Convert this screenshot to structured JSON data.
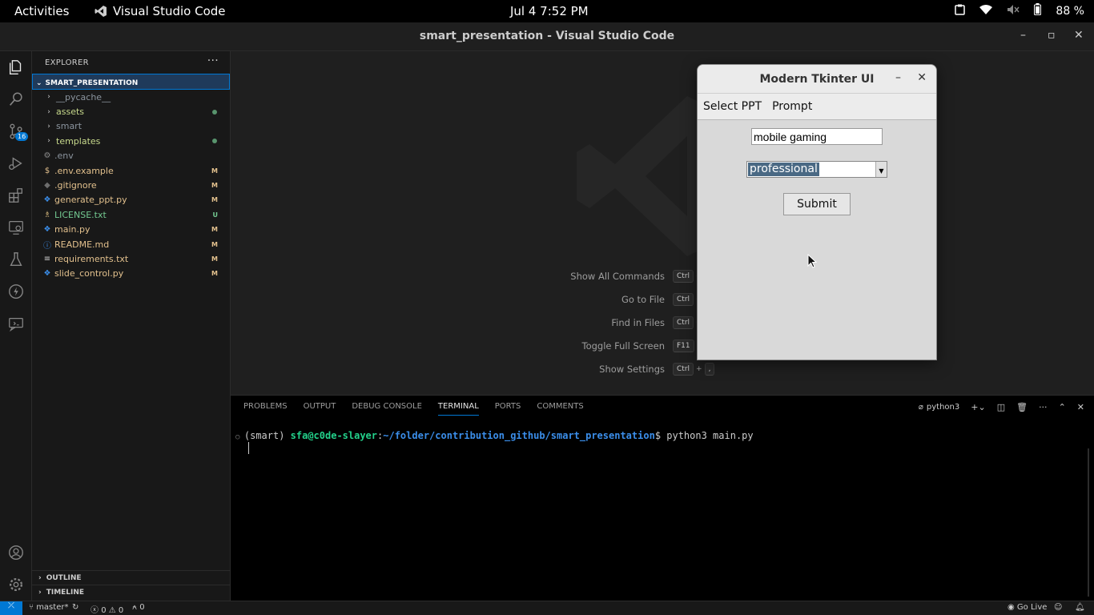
{
  "topbar": {
    "activities": "Activities",
    "app_name": "Visual Studio Code",
    "clock": "Jul 4   7:52 PM",
    "battery": "88 %"
  },
  "window": {
    "title": "smart_presentation - Visual Studio Code",
    "minimize": "–",
    "maximize": "▫",
    "close": "✕"
  },
  "activity_bar": {
    "scm_badge": "16"
  },
  "explorer": {
    "header": "EXPLORER",
    "more": "···",
    "project": "SMART_PRESENTATION",
    "items": [
      {
        "name": "__pycache__",
        "type": "folder",
        "color": "#8b949e",
        "decoration": ""
      },
      {
        "name": "assets",
        "type": "folder",
        "color": "#c7d98c",
        "decoration": "dot"
      },
      {
        "name": "smart",
        "type": "folder",
        "color": "#8b949e",
        "decoration": ""
      },
      {
        "name": "templates",
        "type": "folder",
        "color": "#c7d98c",
        "decoration": "dot"
      },
      {
        "name": ".env",
        "type": "file",
        "icon": "⚙",
        "icon_color": "#8a8a8a",
        "color": "#8b949e",
        "decoration": ""
      },
      {
        "name": ".env.example",
        "type": "file",
        "icon": "$",
        "icon_color": "#e2c08d",
        "color": "#e2c08d",
        "decoration": "M"
      },
      {
        "name": ".gitignore",
        "type": "file",
        "icon": "◆",
        "icon_color": "#6d6d6d",
        "color": "#e2c08d",
        "decoration": "M"
      },
      {
        "name": "generate_ppt.py",
        "type": "file",
        "icon": "❖",
        "icon_color": "#3b8eea",
        "color": "#e2c08d",
        "decoration": "M"
      },
      {
        "name": "LICENSE.txt",
        "type": "file",
        "icon": "♗",
        "icon_color": "#d7ba7d",
        "color": "#73c991",
        "decoration": "U"
      },
      {
        "name": "main.py",
        "type": "file",
        "icon": "❖",
        "icon_color": "#3b8eea",
        "color": "#e2c08d",
        "decoration": "M"
      },
      {
        "name": "README.md",
        "type": "file",
        "icon": "ⓘ",
        "icon_color": "#3b8eea",
        "color": "#e2c08d",
        "decoration": "M"
      },
      {
        "name": "requirements.txt",
        "type": "file",
        "icon": "≡",
        "icon_color": "#cccccc",
        "color": "#e2c08d",
        "decoration": "M"
      },
      {
        "name": "slide_control.py",
        "type": "file",
        "icon": "❖",
        "icon_color": "#3b8eea",
        "color": "#e2c08d",
        "decoration": "M"
      }
    ],
    "outline": "OUTLINE",
    "timeline": "TIMELINE"
  },
  "welcome": {
    "shortcuts": [
      {
        "label": "Show All Commands",
        "keys": [
          "Ctrl",
          "+"
        ]
      },
      {
        "label": "Go to File",
        "keys": [
          "Ctrl",
          "+"
        ]
      },
      {
        "label": "Find in Files",
        "keys": [
          "Ctrl",
          "+"
        ]
      },
      {
        "label": "Toggle Full Screen",
        "keys": [
          "F11"
        ]
      },
      {
        "label": "Show Settings",
        "keys": [
          "Ctrl",
          "+",
          ","
        ]
      }
    ]
  },
  "panel": {
    "tabs": [
      "PROBLEMS",
      "OUTPUT",
      "DEBUG CONSOLE",
      "TERMINAL",
      "PORTS",
      "COMMENTS"
    ],
    "active_tab": "TERMINAL",
    "shell": "python3",
    "terminal": {
      "env": "(smart) ",
      "user_host": "sfa@c0de-slayer",
      "path": "~/folder/contribution_github/smart_presentation",
      "command": "$ python3 main.py"
    }
  },
  "statusbar": {
    "branch": "master*",
    "errors": "0",
    "warnings": "0",
    "ports": "0",
    "go_live": "Go Live"
  },
  "tkinter": {
    "title": "Modern Tkinter UI",
    "menu": [
      "Select PPT",
      "Prompt"
    ],
    "entry_value": "mobile gaming",
    "combo_value": "professional",
    "submit": "Submit"
  },
  "colors": {
    "accent": "#0078d4",
    "terminal_user": "#23d18b",
    "terminal_path": "#3b8eea"
  }
}
